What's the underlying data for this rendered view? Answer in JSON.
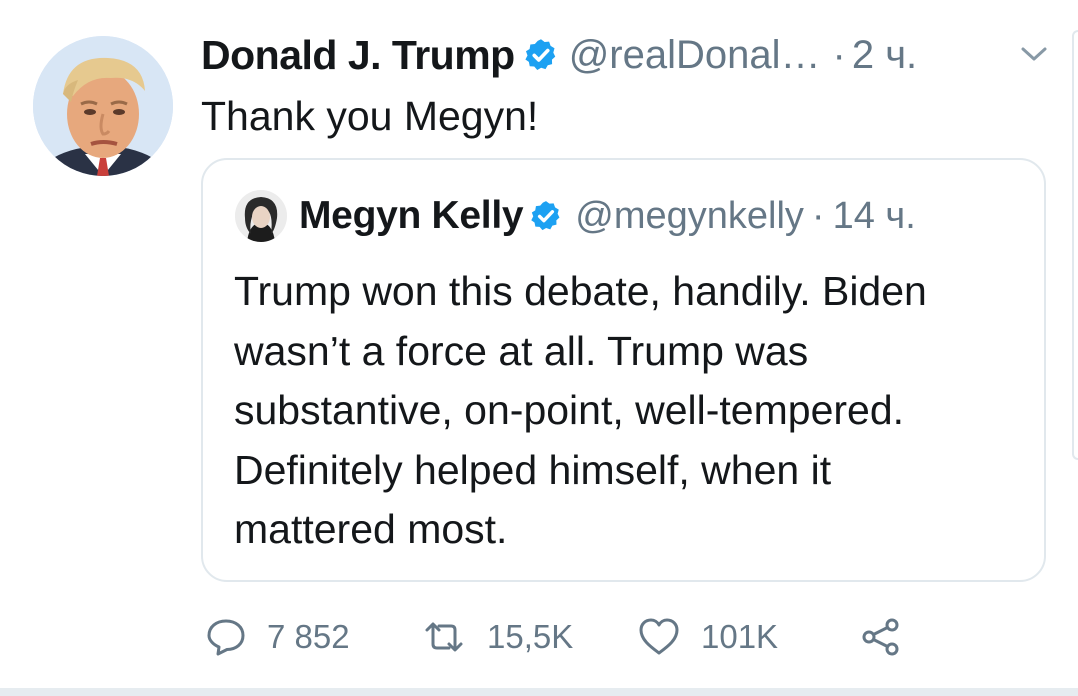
{
  "tweet": {
    "author_name": "Donald J. Trump",
    "handle": "@realDonal…",
    "separator": "·",
    "time": "2 ч.",
    "text": "Thank you Megyn!",
    "avatar_icon": "profile-photo",
    "verified_icon": "verified-badge-icon",
    "menu_icon": "chevron-down-icon"
  },
  "quoted": {
    "author_name": "Megyn Kelly",
    "handle": "@megynkelly",
    "separator": "·",
    "time": "14 ч.",
    "lines": [
      "Trump won this debate, handily. Biden",
      "wasn’t a force at all. Trump was",
      "substantive, on-point, well-tempered.",
      "Definitely helped himself, when it",
      "mattered most."
    ]
  },
  "actions": {
    "reply_count": "7 852",
    "retweet_count": "15,5K",
    "like_count": "101K",
    "reply_icon": "reply-icon",
    "retweet_icon": "retweet-icon",
    "like_icon": "heart-icon",
    "share_icon": "share-icon"
  },
  "colors": {
    "text_primary": "#14171a",
    "text_secondary": "#657786",
    "verified_blue": "#1da1f2",
    "border": "#e1e8ed"
  }
}
